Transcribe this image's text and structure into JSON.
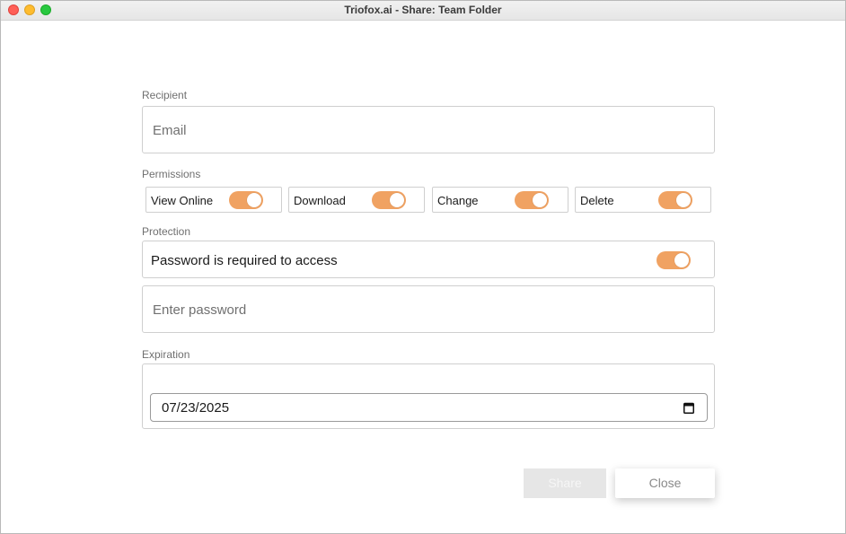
{
  "window": {
    "title": "Triofox.ai - Share: Team Folder"
  },
  "recipient": {
    "label": "Recipient",
    "email_placeholder": "Email"
  },
  "permissions": {
    "label": "Permissions",
    "items": [
      {
        "label": "View Online",
        "enabled": true
      },
      {
        "label": "Download",
        "enabled": true
      },
      {
        "label": "Change",
        "enabled": true
      },
      {
        "label": "Delete",
        "enabled": true
      }
    ]
  },
  "protection": {
    "label": "Protection",
    "password_required_label": "Password is required to access",
    "password_required": true,
    "password_placeholder": "Enter password"
  },
  "expiration": {
    "label": "Expiration",
    "date_value": "07/23/2025"
  },
  "buttons": {
    "share_label": "Share",
    "close_label": "Close"
  },
  "colors": {
    "toggle_on": "#f0a262",
    "share_disabled_bg": "#e6e6e6"
  }
}
